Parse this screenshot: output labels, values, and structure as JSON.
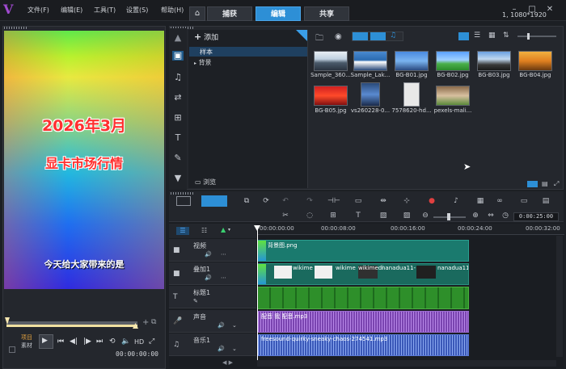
{
  "menubar": {
    "items": [
      "文件(F)",
      "编辑(E)",
      "工具(T)",
      "设置(S)",
      "帮助(H)"
    ],
    "tabs": [
      "捕获",
      "编辑",
      "共享"
    ],
    "resolution": "1, 1080*1920"
  },
  "preview": {
    "title_line1": "2026年3月",
    "title_line2": "显卡市场行情",
    "subtitle": "今天给大家带来的是",
    "mode_project": "项目",
    "mode_clip": "素材",
    "hd_label": "HD",
    "timecode": "00:00:00:00"
  },
  "library": {
    "add_label": "添加",
    "folders": [
      "样本",
      "背景"
    ],
    "browse_label": "浏览",
    "thumbnails": [
      "Sample_360...",
      "Sample_Lak...",
      "BG-B01.jpg",
      "BG-B02.jpg",
      "BG-B03.jpg",
      "BG-B04.jpg",
      "BG-B05.jpg",
      "vs260228-0...",
      "7578620-hd...",
      "pexels-mali..."
    ]
  },
  "timeline": {
    "timecode": "0:00:25:00",
    "ruler": [
      "00:00:00:00",
      "00:00:08:00",
      "00:00:16:00",
      "00:00:24:00",
      "00:00:32:00"
    ],
    "tracks": [
      "视频",
      "叠加1",
      "标题1",
      "声音",
      "音乐1"
    ],
    "clips": {
      "video": "背景图.png",
      "overlay": [
        "wikime",
        "wikime",
        "wikimedi",
        "nanadua11-",
        "nanadua11"
      ],
      "voice": "配音 我 配音.mp3",
      "music": "freesound-quirky-sneaky-chaos-274541.mp3"
    }
  },
  "colors": {
    "accent": "#2d8fd6",
    "video_clip": "#1a7a6e",
    "title_clip": "#2e8f2a",
    "voice_clip": "#7a44b0",
    "music_clip": "#3a58b8"
  }
}
